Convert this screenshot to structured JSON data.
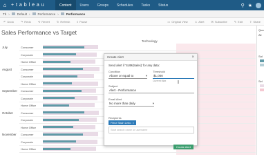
{
  "topnav": {
    "logo": "+ t a b l e a u",
    "tabs": [
      {
        "label": "Content",
        "active": true
      },
      {
        "label": "Users",
        "active": false
      },
      {
        "label": "Groups",
        "active": false
      },
      {
        "label": "Schedules",
        "active": false
      },
      {
        "label": "Tasks",
        "active": false
      },
      {
        "label": "Status",
        "active": false
      }
    ]
  },
  "breadcrumb": {
    "items": [
      "Tb",
      "Default",
      "Performance",
      "Performance"
    ]
  },
  "toolbar": {
    "left": [
      "Undo",
      "Redo",
      "Revert",
      "Refresh",
      "Pause"
    ],
    "right": [
      "Original View",
      "Alert",
      "Subscribe",
      "Edit",
      "Share"
    ]
  },
  "viz": {
    "title": "Sales Performance vs Target",
    "column_header": "Technology",
    "rows": [
      {
        "month": "July",
        "segments": [
          "Consumer",
          "Corporate",
          "Home Office"
        ]
      },
      {
        "month": "August",
        "segments": [
          "Consumer",
          "Corporate",
          "Home Office"
        ]
      },
      {
        "month": "September",
        "segments": [
          "Consumer",
          "Corporate",
          "Home Office"
        ]
      },
      {
        "month": "October",
        "segments": [
          "Consumer",
          "Corporate",
          "Home Office"
        ]
      },
      {
        "month": "November",
        "segments": [
          "Consumer",
          "Corporate",
          "Home Office"
        ]
      }
    ]
  },
  "sidebar": {
    "label1": "Qua",
    "label2": "All",
    "label3": "Sal",
    "label4": "Sel"
  },
  "dialog": {
    "title": "Create Alert",
    "intro": "Send alert if 'SUM(Sales)' for any data:",
    "condition_label": "Condition",
    "condition_value": "Above or equal to",
    "threshold_label": "Threshold",
    "threshold_value": "$1,000",
    "threshold_hint": "Current Max",
    "subject_label": "Subject",
    "subject_value": "Alert - Performance",
    "email_label": "Email Alert",
    "email_value": "No more than daily",
    "recipients_label": "Recipients",
    "recipient_chip": "Fleur Sbah Lebo",
    "search_placeholder": "Start search name or username",
    "create_button": "Create Alert"
  },
  "colors": {
    "nav": "#1f5b86",
    "bar": "#5f9aa7",
    "target": "#fbe8ec",
    "create_button": "#3c9e6f",
    "chip": "#2c7ab8"
  }
}
